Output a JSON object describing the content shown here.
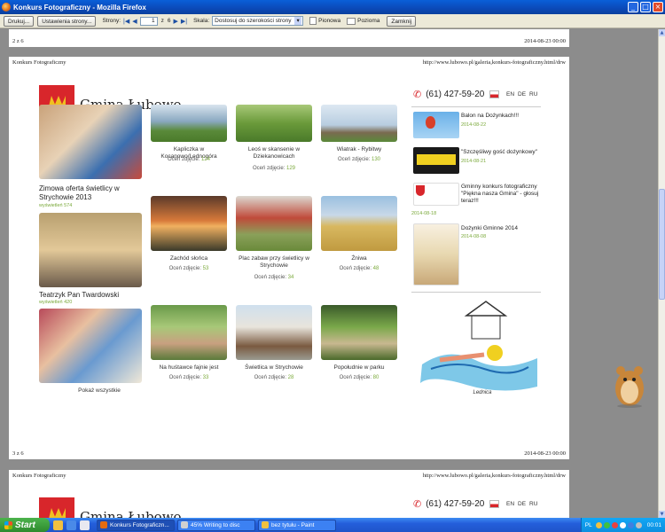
{
  "window": {
    "title": "Konkurs Fotograficzny - Mozilla Firefox"
  },
  "toolbar": {
    "print_label": "Drukuj...",
    "page_setup_label": "Ustawienia strony...",
    "pages_label": "Strony:",
    "current_page": "1",
    "of_label": "z",
    "total_pages": "6",
    "scale_label": "Skala:",
    "scale_value": "Dostosuj do szerokości strony",
    "portrait_label": "Pionowa",
    "landscape_label": "Pozioma",
    "close_label": "Zamknij"
  },
  "sheet_prev": {
    "page_counter": "2 z 6",
    "datetime": "2014-08-23 00:00"
  },
  "sheet_main": {
    "site_title": "Konkurs Fotograficzny",
    "url": "http://www.lubowo.pl/galeria,konkurs-fotograficzny.html/drw",
    "page_counter": "3 z 6",
    "datetime": "2014-08-23 00:00"
  },
  "sheet_next": {
    "site_title": "Konkurs Fotograficzny",
    "url": "http://www.lubowo.pl/galeria,konkurs-fotograficzny.html/drw"
  },
  "site": {
    "logo_text": "Gmina Łubowo",
    "phone": "(61) 427-59-20",
    "languages": [
      "EN",
      "DE",
      "RU"
    ],
    "show_all": "Pokaż wszystkie",
    "rating_label": "Oceń zdjęcie:"
  },
  "categories": [
    {
      "title": "Zimowa oferta świetlicy w Strychowie 2013",
      "views": "wyświetleń 574"
    },
    {
      "title": "Teatrzyk Pan Twardowski",
      "views": "wyświetleń 420"
    }
  ],
  "photos": [
    {
      "title": "Kapliczka w Kocanowo/Lednogóra",
      "score": "124"
    },
    {
      "title": "Leoś w skansenie w Dziekanowicach",
      "score": "129"
    },
    {
      "title": "Wiatrak - Rybitwy",
      "score": "130"
    },
    {
      "title": "Zachód słońca",
      "score": "53"
    },
    {
      "title": "Plac zabaw przy świetlicy w Strychowie",
      "score": "34"
    },
    {
      "title": "Żniwa",
      "score": "48"
    },
    {
      "title": "Na huśtawce fajnie jest",
      "score": "33"
    },
    {
      "title": "Świetlica w Strychowie",
      "score": "28"
    },
    {
      "title": "Popołudnie w parku",
      "score": "80"
    }
  ],
  "news": [
    {
      "title": "Balon na Dożynkach!!!",
      "date": "2014-08-22"
    },
    {
      "title": "\"Szczęśliwy gość dożynkowy\"",
      "date": "2014-08-21"
    },
    {
      "title": "Gminny konkurs fotograficzny \"Piękna nasza Gmina\" - głosuj teraz!!!",
      "date": "2014-08-18"
    },
    {
      "title": "Dożynki Gminne 2014",
      "date": "2014-08-08"
    }
  ],
  "promo": {
    "image_text": "Lednica"
  },
  "taskbar": {
    "start_label": "Start",
    "tasks": [
      "Konkurs Fotograficzn...",
      "45% Writing to disc",
      "bez tytułu - Paint"
    ],
    "lang": "PL",
    "time": "00:01"
  }
}
